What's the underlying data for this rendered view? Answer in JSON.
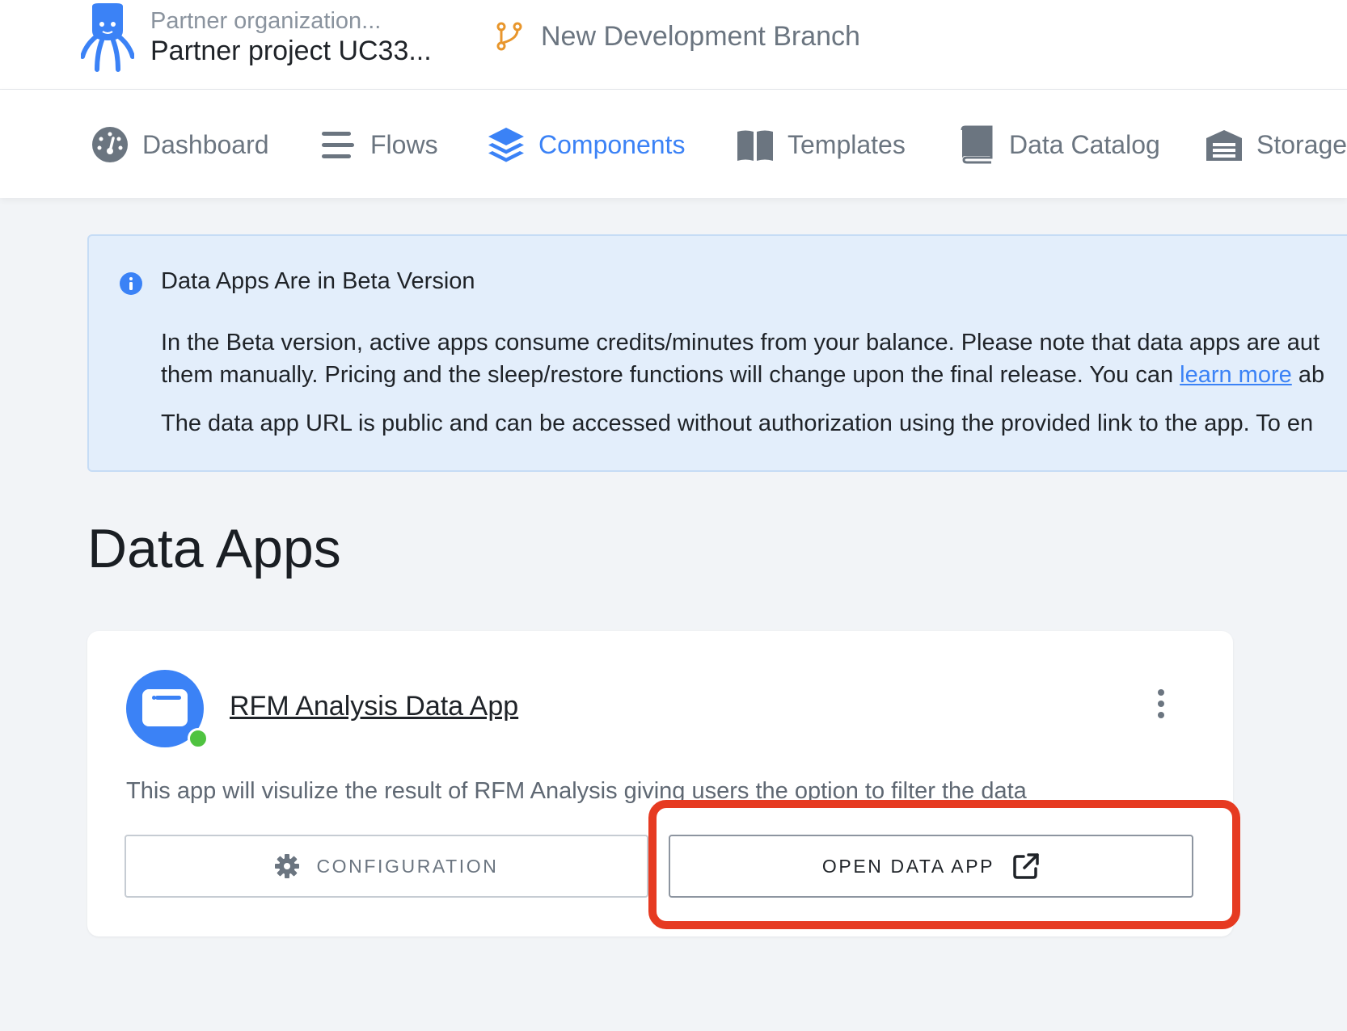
{
  "header": {
    "organization": "Partner organization...",
    "project": "Partner project UC33...",
    "branch": "New Development Branch"
  },
  "nav": {
    "items": [
      {
        "label": "Dashboard",
        "icon": "dashboard-icon",
        "active": false
      },
      {
        "label": "Flows",
        "icon": "flows-icon",
        "active": false
      },
      {
        "label": "Components",
        "icon": "components-icon",
        "active": true
      },
      {
        "label": "Templates",
        "icon": "templates-icon",
        "active": false
      },
      {
        "label": "Data Catalog",
        "icon": "data-catalog-icon",
        "active": false
      },
      {
        "label": "Storage",
        "icon": "storage-icon",
        "active": false
      }
    ]
  },
  "banner": {
    "title": "Data Apps Are in Beta Version",
    "line1": "In the Beta version, active apps consume credits/minutes from your balance. Please note that data apps are aut",
    "line2_before": "them manually. Pricing and the sleep/restore functions will change upon the final release. You can ",
    "line2_link": "learn more",
    "line2_after": " ab",
    "line3": "The data app URL is public and can be accessed without authorization using the provided link to the app. To en"
  },
  "page": {
    "title": "Data Apps"
  },
  "app_card": {
    "name": "RFM Analysis Data App",
    "description": "This app will visulize the result of RFM Analysis giving users the option to filter the data",
    "status": "running",
    "config_button": "CONFIGURATION",
    "open_button": "OPEN DATA APP"
  },
  "colors": {
    "accent": "#3b82f6",
    "branch_icon": "#e8962c",
    "status_running": "#4fc340",
    "highlight": "#e63a21",
    "banner_bg": "#e3eefb"
  }
}
